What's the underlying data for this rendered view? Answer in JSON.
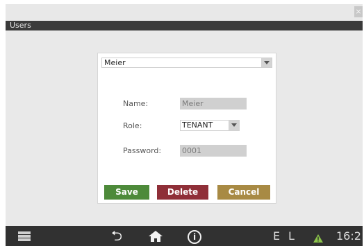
{
  "window": {
    "title": "Users",
    "close_glyph": "×"
  },
  "user_select": {
    "value": "Meier"
  },
  "form": {
    "name_label": "Name:",
    "name_value": "Meier",
    "role_label": "Role:",
    "role_value": "TENANT",
    "password_label": "Password:",
    "password_value": "0001"
  },
  "buttons": {
    "save": "Save",
    "delete": "Delete",
    "cancel": "Cancel"
  },
  "taskbar": {
    "icons": [
      "menu-icon",
      "back-icon",
      "home-icon",
      "info-icon",
      "warning-icon"
    ],
    "back_glyph": "⮌",
    "info_glyph": "i",
    "status_e": "E",
    "status_l": "L",
    "clock": "16:2"
  },
  "colors": {
    "save": "#4d8a3a",
    "delete": "#8f2f38",
    "cancel": "#a88a44",
    "warning": "#8bc34a",
    "titlebar": "#3a3a3a",
    "taskbar": "#313131"
  }
}
